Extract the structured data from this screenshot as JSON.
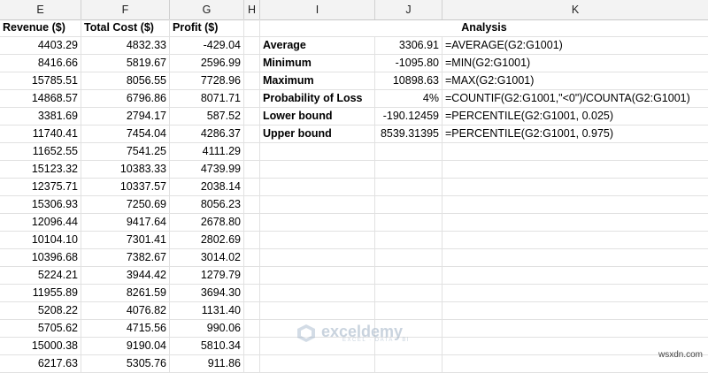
{
  "columns": [
    "E",
    "F",
    "G",
    "H",
    "I",
    "J",
    "K"
  ],
  "headers": {
    "revenue": "Revenue ($)",
    "total_cost": "Total Cost ($)",
    "profit": "Profit ($)",
    "analysis": "Analysis"
  },
  "data_rows": [
    [
      "4403.29",
      "4832.33",
      "-429.04"
    ],
    [
      "8416.66",
      "5819.67",
      "2596.99"
    ],
    [
      "15785.51",
      "8056.55",
      "7728.96"
    ],
    [
      "14868.57",
      "6796.86",
      "8071.71"
    ],
    [
      "3381.69",
      "2794.17",
      "587.52"
    ],
    [
      "11740.41",
      "7454.04",
      "4286.37"
    ],
    [
      "11652.55",
      "7541.25",
      "4111.29"
    ],
    [
      "15123.32",
      "10383.33",
      "4739.99"
    ],
    [
      "12375.71",
      "10337.57",
      "2038.14"
    ],
    [
      "15306.93",
      "7250.69",
      "8056.23"
    ],
    [
      "12096.44",
      "9417.64",
      "2678.80"
    ],
    [
      "10104.10",
      "7301.41",
      "2802.69"
    ],
    [
      "10396.68",
      "7382.67",
      "3014.02"
    ],
    [
      "5224.21",
      "3944.42",
      "1279.79"
    ],
    [
      "11955.89",
      "8261.59",
      "3694.30"
    ],
    [
      "5208.22",
      "4076.82",
      "1131.40"
    ],
    [
      "5705.62",
      "4715.56",
      "990.06"
    ],
    [
      "15000.38",
      "9190.04",
      "5810.34"
    ],
    [
      "6217.63",
      "5305.76",
      "911.86"
    ]
  ],
  "analysis_rows": [
    {
      "label": "Average",
      "value": "3306.91",
      "formula": "=AVERAGE(G2:G1001)"
    },
    {
      "label": "Minimum",
      "value": "-1095.80",
      "formula": "=MIN(G2:G1001)"
    },
    {
      "label": "Maximum",
      "value": "10898.63",
      "formula": "=MAX(G2:G1001)"
    },
    {
      "label": "Probability of Loss",
      "value": "4%",
      "formula": "=COUNTIF(G2:G1001,\"<0\")/COUNTA(G2:G1001)"
    },
    {
      "label": "Lower bound",
      "value": "-190.12459",
      "formula": "=PERCENTILE(G2:G1001, 0.025)"
    },
    {
      "label": "Upper bound",
      "value": "8539.31395",
      "formula": "=PERCENTILE(G2:G1001, 0.975)"
    }
  ],
  "watermark": {
    "name": "exceldemy",
    "tagline": "EXCEL · DATA · BI"
  },
  "site": "wsxdn.com"
}
